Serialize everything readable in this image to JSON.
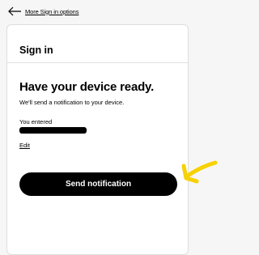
{
  "nav": {
    "back_label": "More Sign in options",
    "back_icon": "arrow-left-icon"
  },
  "card": {
    "title": "Sign in",
    "heading": "Have your device ready.",
    "subtext": "We'll send a notification to your device.",
    "entered_label": "You entered",
    "entered_value_redacted": true,
    "edit_label": "Edit",
    "send_button_label": "Send notification"
  },
  "colors": {
    "button": "#000000",
    "annotation": "#f7d100",
    "background": "#f6f6f6"
  }
}
